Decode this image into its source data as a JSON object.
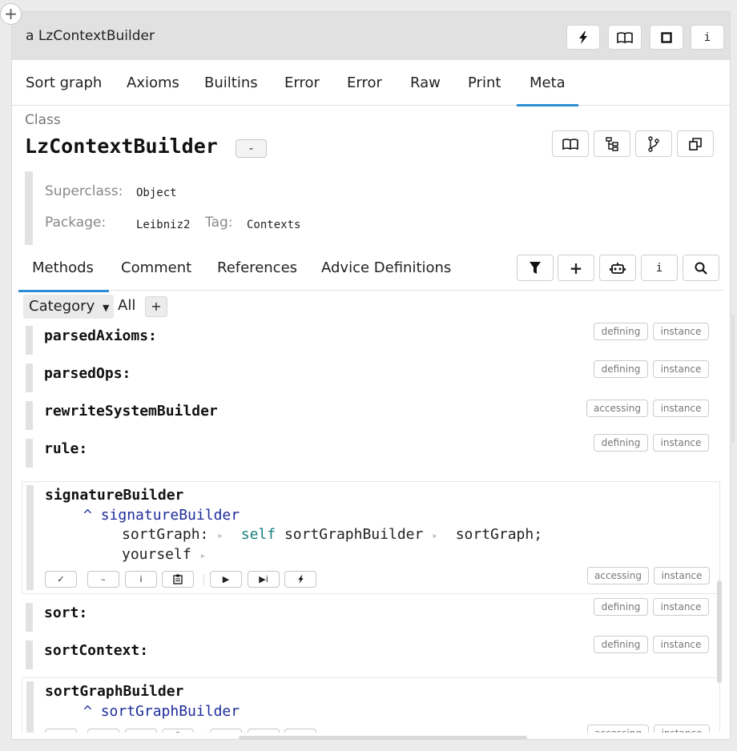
{
  "window": {
    "title": "a LzContextBuilder",
    "toolbar": {
      "flash": "lightning-icon",
      "book": "book-icon",
      "square": "square-icon",
      "info": "i"
    }
  },
  "view_tabs": [
    "Sort graph",
    "Axioms",
    "Builtins",
    "Error",
    "Error",
    "Raw",
    "Print",
    "Meta"
  ],
  "active_view_tab": "Meta",
  "class": {
    "label": "Class",
    "name": "LzContextBuilder",
    "minus_label": "-",
    "superclass_label": "Superclass:",
    "superclass": "Object",
    "package_label": "Package:",
    "package": "Leibniz2",
    "tag_label": "Tag:",
    "tag": "Contexts"
  },
  "method_tabs": [
    "Methods",
    "Comment",
    "References",
    "Advice Definitions"
  ],
  "active_method_tab": "Methods",
  "method_tools": {
    "filter": "filter-icon",
    "add": "+",
    "robot": "robot-icon",
    "info": "i",
    "search": "search-icon"
  },
  "category_filter": {
    "dropdown": "Category",
    "value": "All",
    "add": "+"
  },
  "methods": [
    {
      "name": "parsedAxioms:",
      "protocol": "defining",
      "side": "instance"
    },
    {
      "name": "parsedOps:",
      "protocol": "defining",
      "side": "instance"
    },
    {
      "name": "rewriteSystemBuilder",
      "protocol": "accessing",
      "side": "instance"
    },
    {
      "name": "rule:",
      "protocol": "defining",
      "side": "instance"
    },
    {
      "name": "signatureBuilder",
      "protocol": "accessing",
      "side": "instance"
    },
    {
      "name": "sort:",
      "protocol": "defining",
      "side": "instance"
    },
    {
      "name": "sortContext:",
      "protocol": "defining",
      "side": "instance"
    },
    {
      "name": "sortGraphBuilder",
      "protocol": "accessing",
      "side": "instance"
    }
  ],
  "code": {
    "caret": "^",
    "self": "self",
    "sig_ret": "signatureBuilder",
    "sig_send1": "sortGraph:",
    "sig_recv": "sortGraphBuilder",
    "sig_send2": "sortGraph;",
    "sig_yourself": "yourself",
    "sg_ret": "sortGraphBuilder",
    "arrow": "▸"
  },
  "actions": {
    "accept": "✓",
    "remove": "–",
    "inspect": "i",
    "copy": "clipboard-icon",
    "run": "▶",
    "run_inspect": "▶i",
    "debug": "lightning-icon"
  }
}
